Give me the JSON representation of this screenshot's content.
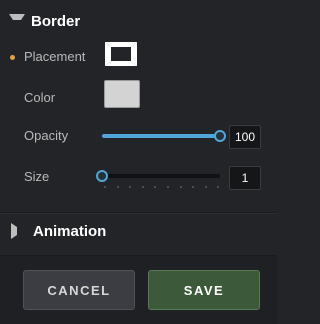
{
  "border": {
    "title": "Border",
    "placement": {
      "label": "Placement",
      "icon": "border-placement-icon"
    },
    "color": {
      "label": "Color",
      "value": "#d3d3d3"
    },
    "opacity": {
      "label": "Opacity",
      "value": "100",
      "fraction": 1.0
    },
    "size": {
      "label": "Size",
      "value": "1",
      "fraction": 0.0
    }
  },
  "animation": {
    "title": "Animation"
  },
  "footer": {
    "cancel_label": "CANCEL",
    "save_label": "SAVE"
  },
  "colors": {
    "accent": "#4fa6d8",
    "modified": "#e0a23a",
    "save_bg": "#3c5a3a"
  }
}
